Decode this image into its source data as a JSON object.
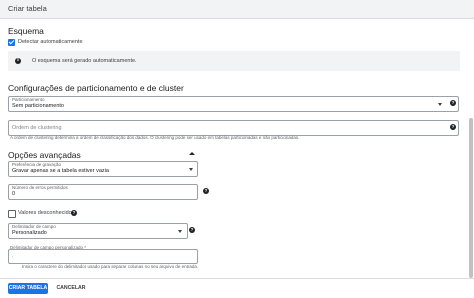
{
  "dialog": {
    "title": "Criar tabela"
  },
  "schema": {
    "heading": "Esquema",
    "auto_detect_label": "Detectar automaticamente",
    "auto_detect_checked": true,
    "info_text": "O esquema será gerado automaticamente."
  },
  "partitioning": {
    "heading": "Configurações de particionamento e de cluster",
    "partition_label": "Particionamento",
    "partition_value": "Sem particionamento",
    "clustering_placeholder": "Ordem de clustering",
    "clustering_help": "A ordem de clustering determina a ordem de classificação dos dados. O clustering pode ser usado em tabelas particionadas e não particionadas."
  },
  "advanced": {
    "heading": "Opções avançadas",
    "write_pref_label": "Preferência de gravação",
    "write_pref_value": "Gravar apenas se a tabela estiver vazia",
    "errors_label": "Número de erros permitidos",
    "errors_value": "0",
    "unknown_values_label": "Valores desconhecidos",
    "unknown_values_checked": false,
    "delimiter_label": "Delimitador de campo",
    "delimiter_value": "Personalizado",
    "custom_delimiter_label": "Delimitador de campo personalizado *",
    "custom_delimiter_value": ",",
    "custom_delimiter_help": "Insira o caractere do delimitador usado para separar colunas no seu arquivo de entrada."
  },
  "footer": {
    "create_label": "CRIAR TABELA",
    "cancel_label": "CANCELAR"
  },
  "icons": {
    "help": "help-circle-icon",
    "info": "info-icon",
    "dropdown": "arrow-drop-down-icon",
    "collapse": "chevron-up-icon"
  },
  "colors": {
    "accent": "#1a73e8",
    "info_bg": "#f1f3f4"
  }
}
